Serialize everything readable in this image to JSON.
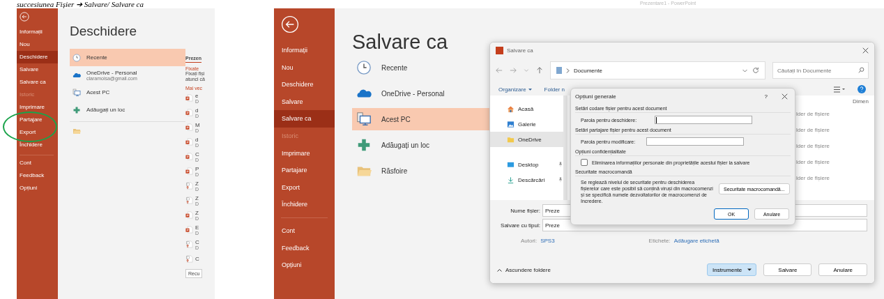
{
  "caption": "succesiunea Fișier ➔ Salvare/ Salvare ca",
  "open_view": {
    "menu": [
      {
        "label": "Informații",
        "selected": false,
        "disabled": false
      },
      {
        "label": "Nou",
        "selected": false,
        "disabled": false
      },
      {
        "label": "Deschidere",
        "selected": true,
        "disabled": false
      },
      {
        "label": "Salvare",
        "selected": false,
        "disabled": false
      },
      {
        "label": "Salvare ca",
        "selected": false,
        "disabled": false
      },
      {
        "label": "Istoric",
        "selected": false,
        "disabled": true
      },
      {
        "label": "Imprimare",
        "selected": false,
        "disabled": false
      },
      {
        "label": "Partajare",
        "selected": false,
        "disabled": false
      },
      {
        "label": "Export",
        "selected": false,
        "disabled": false
      },
      {
        "label": "Închidere",
        "selected": false,
        "disabled": false
      },
      {
        "label": "Cont",
        "selected": false,
        "disabled": false
      },
      {
        "label": "Feedback",
        "selected": false,
        "disabled": false
      },
      {
        "label": "Opțiuni",
        "selected": false,
        "disabled": false
      }
    ],
    "title": "Deschidere",
    "places": [
      {
        "kind": "recent",
        "label": "Recente",
        "selected": true
      },
      {
        "kind": "onedrive",
        "label": "OneDrive - Personal",
        "sublabel": "claramoisa@gmail.com",
        "selected": false
      },
      {
        "kind": "pc",
        "label": "Acest PC",
        "selected": false
      },
      {
        "kind": "add",
        "label": "Adăugați un loc",
        "selected": false
      },
      {
        "kind": "browse",
        "selected": false
      }
    ],
    "recent_panel": {
      "tab": "Prezen",
      "pinned_heading": "Fixate",
      "pinned_hint": [
        "Fixați fiși",
        "atunci câ"
      ],
      "older_heading": "Mai vec",
      "files": [
        {
          "kind": "ppt",
          "name": "e",
          "detail": "D"
        },
        {
          "kind": "ppt",
          "name": "d",
          "detail": "D"
        },
        {
          "kind": "ppt",
          "name": "M",
          "detail": "D"
        },
        {
          "kind": "ppt",
          "name": "d",
          "detail": "D"
        },
        {
          "kind": "ppt",
          "name": "C",
          "detail": "D"
        },
        {
          "kind": "ppt",
          "name": "P",
          "detail": "D"
        },
        {
          "kind": "show",
          "name": "Z",
          "detail": "D"
        },
        {
          "kind": "show",
          "name": "Z",
          "detail": "D"
        },
        {
          "kind": "ppt",
          "name": "Z",
          "detail": "D"
        },
        {
          "kind": "ppt",
          "name": "E",
          "detail": "D"
        },
        {
          "kind": "show",
          "name": "C",
          "detail": "D"
        },
        {
          "kind": "show",
          "name": "C"
        }
      ],
      "button": "Recu"
    }
  },
  "save_view": {
    "window_title": "Prezentare1 - PowerPoint",
    "menu": [
      {
        "label": "Informații",
        "selected": false,
        "disabled": false
      },
      {
        "label": "Nou",
        "selected": false,
        "disabled": false
      },
      {
        "label": "Deschidere",
        "selected": false,
        "disabled": false
      },
      {
        "label": "Salvare",
        "selected": false,
        "disabled": false
      },
      {
        "label": "Salvare ca",
        "selected": true,
        "disabled": false
      },
      {
        "label": "Istoric",
        "selected": false,
        "disabled": true
      },
      {
        "label": "Imprimare",
        "selected": false,
        "disabled": false
      },
      {
        "label": "Partajare",
        "selected": false,
        "disabled": false
      },
      {
        "label": "Export",
        "selected": false,
        "disabled": false
      },
      {
        "label": "Închidere",
        "selected": false,
        "disabled": false
      },
      {
        "label": "Cont",
        "selected": false,
        "disabled": false
      },
      {
        "label": "Feedback",
        "selected": false,
        "disabled": false
      },
      {
        "label": "Opțiuni",
        "selected": false,
        "disabled": false
      }
    ],
    "title": "Salvare ca",
    "places": [
      {
        "kind": "recent",
        "label": "Recente",
        "selected": false
      },
      {
        "kind": "onedrive",
        "label": "OneDrive - Personal",
        "selected": false
      },
      {
        "kind": "pc",
        "label": "Acest PC",
        "selected": true
      },
      {
        "kind": "add",
        "label": "Adăugați un loc",
        "selected": false
      },
      {
        "kind": "browse",
        "label": "Răsfoire",
        "selected": false
      }
    ],
    "dialog": {
      "title": "Salvare ca",
      "address": "Documente",
      "search_placeholder": "Căutați în Documente",
      "organize": "Organizare",
      "new_folder": "Folder n",
      "nav": [
        {
          "kind": "home",
          "label": "Acasă",
          "selected": false,
          "pinned": false
        },
        {
          "kind": "gallery",
          "label": "Galerie",
          "selected": false,
          "pinned": false
        },
        {
          "kind": "onedrive",
          "label": "OneDrive",
          "selected": true,
          "pinned": false
        },
        {
          "kind": "desktop",
          "label": "Desktop",
          "selected": false,
          "pinned": true
        },
        {
          "kind": "downloads",
          "label": "Descărcări",
          "selected": false,
          "pinned": true
        }
      ],
      "column_header": "Dimen",
      "rows": [
        "lder de fișiere",
        "lder de fișiere",
        "lder de fișiere",
        "lder de fișiere",
        "lder de fișiere"
      ],
      "fields": [
        {
          "label": "Nume fișier:",
          "value": "Preze"
        },
        {
          "label": "Salvare cu tipul:",
          "value": "Preze"
        }
      ],
      "meta": [
        {
          "label": "Autori:",
          "value": "SPS3"
        },
        {
          "label": "Etichete:",
          "value": "Adăugare etichetă"
        }
      ],
      "hide_folders": "Ascundere foldere",
      "buttons": [
        {
          "kind": "menu",
          "label": "Instrumente"
        },
        {
          "kind": "plain",
          "label": "Salvare"
        },
        {
          "kind": "plain",
          "label": "Anulare"
        }
      ],
      "options": {
        "title": "Opțiuni generale",
        "help": "?",
        "sections": [
          {
            "kind": "password",
            "heading": "Setări codare fișier pentru acest document",
            "label": "Parola pentru deschidere:",
            "focused": true
          },
          {
            "kind": "password",
            "heading": "Setări partajare fișier pentru acest document",
            "label": "Parola pentru modificare:",
            "focused": false
          },
          {
            "kind": "checkbox",
            "heading": "Opțiuni confidențialitate",
            "label": "Eliminarea informațiilor personale din proprietățile acestui fișier la salvare",
            "checked": false
          },
          {
            "kind": "macro",
            "heading": "Securitate macrocomandă",
            "text": "Se reglează nivelul de securitate pentru deschiderea fișierelor care este posibil să conțină viruși din macrocomenzi și se specifică numele dezvoltatorilor de macrocomenzi de încredere.",
            "button": "Securitate macrocomandă..."
          }
        ],
        "buttons": [
          {
            "label": "OK",
            "default": true
          },
          {
            "label": "Anulare",
            "default": false
          }
        ]
      }
    }
  }
}
